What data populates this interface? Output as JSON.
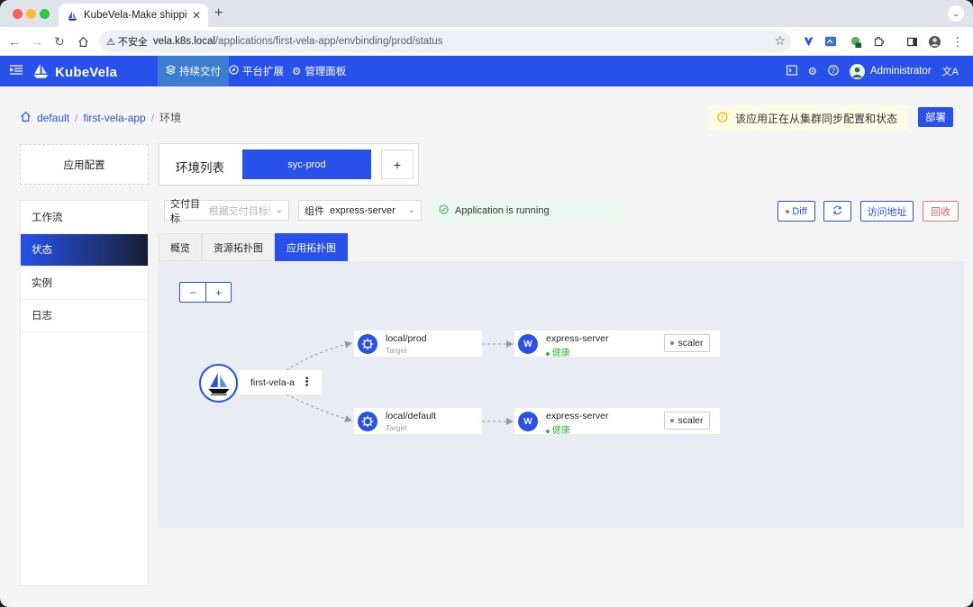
{
  "browser": {
    "tab_title": "KubeVela-Make shipping applications more enjoyable.",
    "new_tab": "+",
    "security_label": "不安全",
    "url_host": "vela.k8s.local",
    "url_path": "/applications/first-vela-app/envbinding/prod/status"
  },
  "header": {
    "brand": "KubeVela",
    "nav": [
      {
        "label": "持续交付",
        "icon": "layers-icon"
      },
      {
        "label": "平台扩展",
        "icon": "compass-icon"
      },
      {
        "label": "管理面板",
        "icon": "gear-icon"
      }
    ],
    "user": "Administrator"
  },
  "breadcrumb": [
    "default",
    "first-vela-app",
    "环境"
  ],
  "alert": {
    "text": "该应用正在从集群同步配置和状态"
  },
  "deploy_label": "部署",
  "app_config_label": "应用配置",
  "env": {
    "label": "环境列表",
    "active_tab": "syc-prod",
    "add": "+"
  },
  "side_menu": [
    {
      "label": "工作流",
      "active": false
    },
    {
      "label": "状态",
      "active": true
    },
    {
      "label": "实例",
      "active": false
    },
    {
      "label": "日志",
      "active": false
    }
  ],
  "filters": {
    "target_label": "交付目标",
    "target_placeholder": "根据交付目标筛选",
    "component_label": "组件",
    "component_value": "express-server"
  },
  "status": {
    "text": "Application is running"
  },
  "actions": {
    "diff": "Diff",
    "visit": "访问地址",
    "recycle": "回收"
  },
  "subtabs": [
    {
      "label": "概览",
      "active": false
    },
    {
      "label": "资源拓扑图",
      "active": false
    },
    {
      "label": "应用拓扑图",
      "active": true
    }
  ],
  "zoom": {
    "out": "−",
    "in": "+"
  },
  "topology": {
    "root": {
      "name": "first-vela-a"
    },
    "targets": [
      {
        "name": "local/prod",
        "type": "Target"
      },
      {
        "name": "local/default",
        "type": "Target"
      }
    ],
    "components": [
      {
        "icon_letter": "W",
        "name": "express-server",
        "health": "健康",
        "trait": "scaler"
      },
      {
        "icon_letter": "W",
        "name": "express-server",
        "health": "健康",
        "trait": "scaler"
      }
    ]
  },
  "colors": {
    "primary": "#2751ea",
    "active_nav": "#3b7dd3",
    "healthy": "#3bb54a",
    "danger": "#f05a5a",
    "alert_bg": "#fffbe6"
  }
}
